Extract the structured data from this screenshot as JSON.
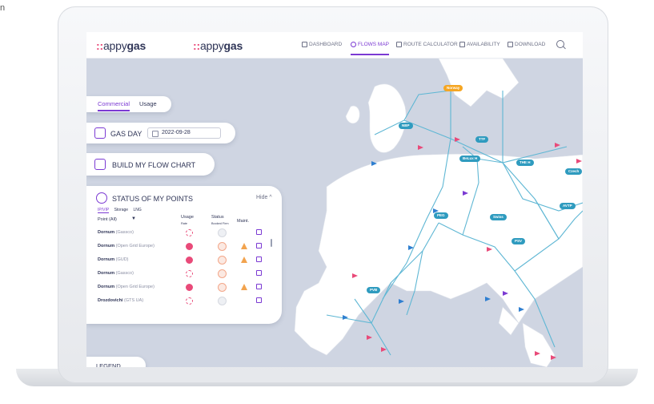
{
  "caption": "n",
  "app": {
    "logo_left": {
      "dots": "::",
      "light": "appy",
      "bold": "gas"
    },
    "logo_right": {
      "dots": "::",
      "light": "appy",
      "bold": "gas"
    }
  },
  "nav": [
    {
      "label": "DASHBOARD",
      "icon": "dashboard-icon",
      "active": false
    },
    {
      "label": "FLOWS MAP",
      "icon": "flows-map-icon",
      "active": true
    },
    {
      "label": "ROUTE CALCULATOR",
      "icon": "route-calculator-icon",
      "active": false
    },
    {
      "label": "AVAILABILITY",
      "icon": "availability-icon",
      "active": false
    },
    {
      "label": "DOWNLOAD",
      "icon": "download-icon",
      "active": false
    }
  ],
  "tabs": {
    "commercial": "Commercial",
    "usage": "Usage"
  },
  "gas_day": {
    "title": "GAS DAY",
    "date": "2022-09-28"
  },
  "flow_chart": {
    "title": "BUILD MY FLOW CHART"
  },
  "status": {
    "title": "STATUS OF MY POINTS",
    "hide": "Hide ^",
    "subtabs": [
      "IP/VIP",
      "Storage",
      "LNG"
    ],
    "columns": {
      "point": "Point (All)",
      "usage": "Usage",
      "usage_sub": "Rate",
      "status": "Status",
      "status_sub": "Booked Firm",
      "maint": "Maint."
    },
    "rows": [
      {
        "name": "Dornum",
        "operator": "(Gassco)",
        "usage_full": false,
        "status_hot": false,
        "warn": false
      },
      {
        "name": "Dornum",
        "operator": "(Open Grid Europe)",
        "usage_full": true,
        "status_hot": true,
        "warn": true
      },
      {
        "name": "Dornum",
        "operator": "(GUD)",
        "usage_full": true,
        "status_hot": true,
        "warn": true
      },
      {
        "name": "Dornum",
        "operator": "(Gassco)",
        "usage_full": false,
        "status_hot": true,
        "warn": false
      },
      {
        "name": "Dornum",
        "operator": "(Open Grid Europe)",
        "usage_full": true,
        "status_hot": true,
        "warn": true
      },
      {
        "name": "Drozdovichi",
        "operator": "(GTS UA)",
        "usage_full": false,
        "status_hot": false,
        "warn": false
      }
    ]
  },
  "legend": "LEGEND",
  "hubs": [
    {
      "label": "Norway",
      "style": "orange"
    },
    {
      "label": "NBP",
      "style": "blue"
    },
    {
      "label": "TTF",
      "style": "blue"
    },
    {
      "label": "BeLux H",
      "style": "blue"
    },
    {
      "label": "THE H",
      "style": "blue"
    },
    {
      "label": "Czech",
      "style": "blue"
    },
    {
      "label": "PEG",
      "style": "blue"
    },
    {
      "label": "Swiss",
      "style": "blue"
    },
    {
      "label": "AVTP",
      "style": "blue"
    },
    {
      "label": "PSV",
      "style": "blue"
    },
    {
      "label": "PVB",
      "style": "blue"
    }
  ],
  "colors": {
    "accent": "#7b3ad3",
    "pink": "#e94a79",
    "hub": "#2f9bbf",
    "pipe": "#5fb7d4",
    "land": "#ffffff",
    "sea": "#cfd5e2"
  }
}
